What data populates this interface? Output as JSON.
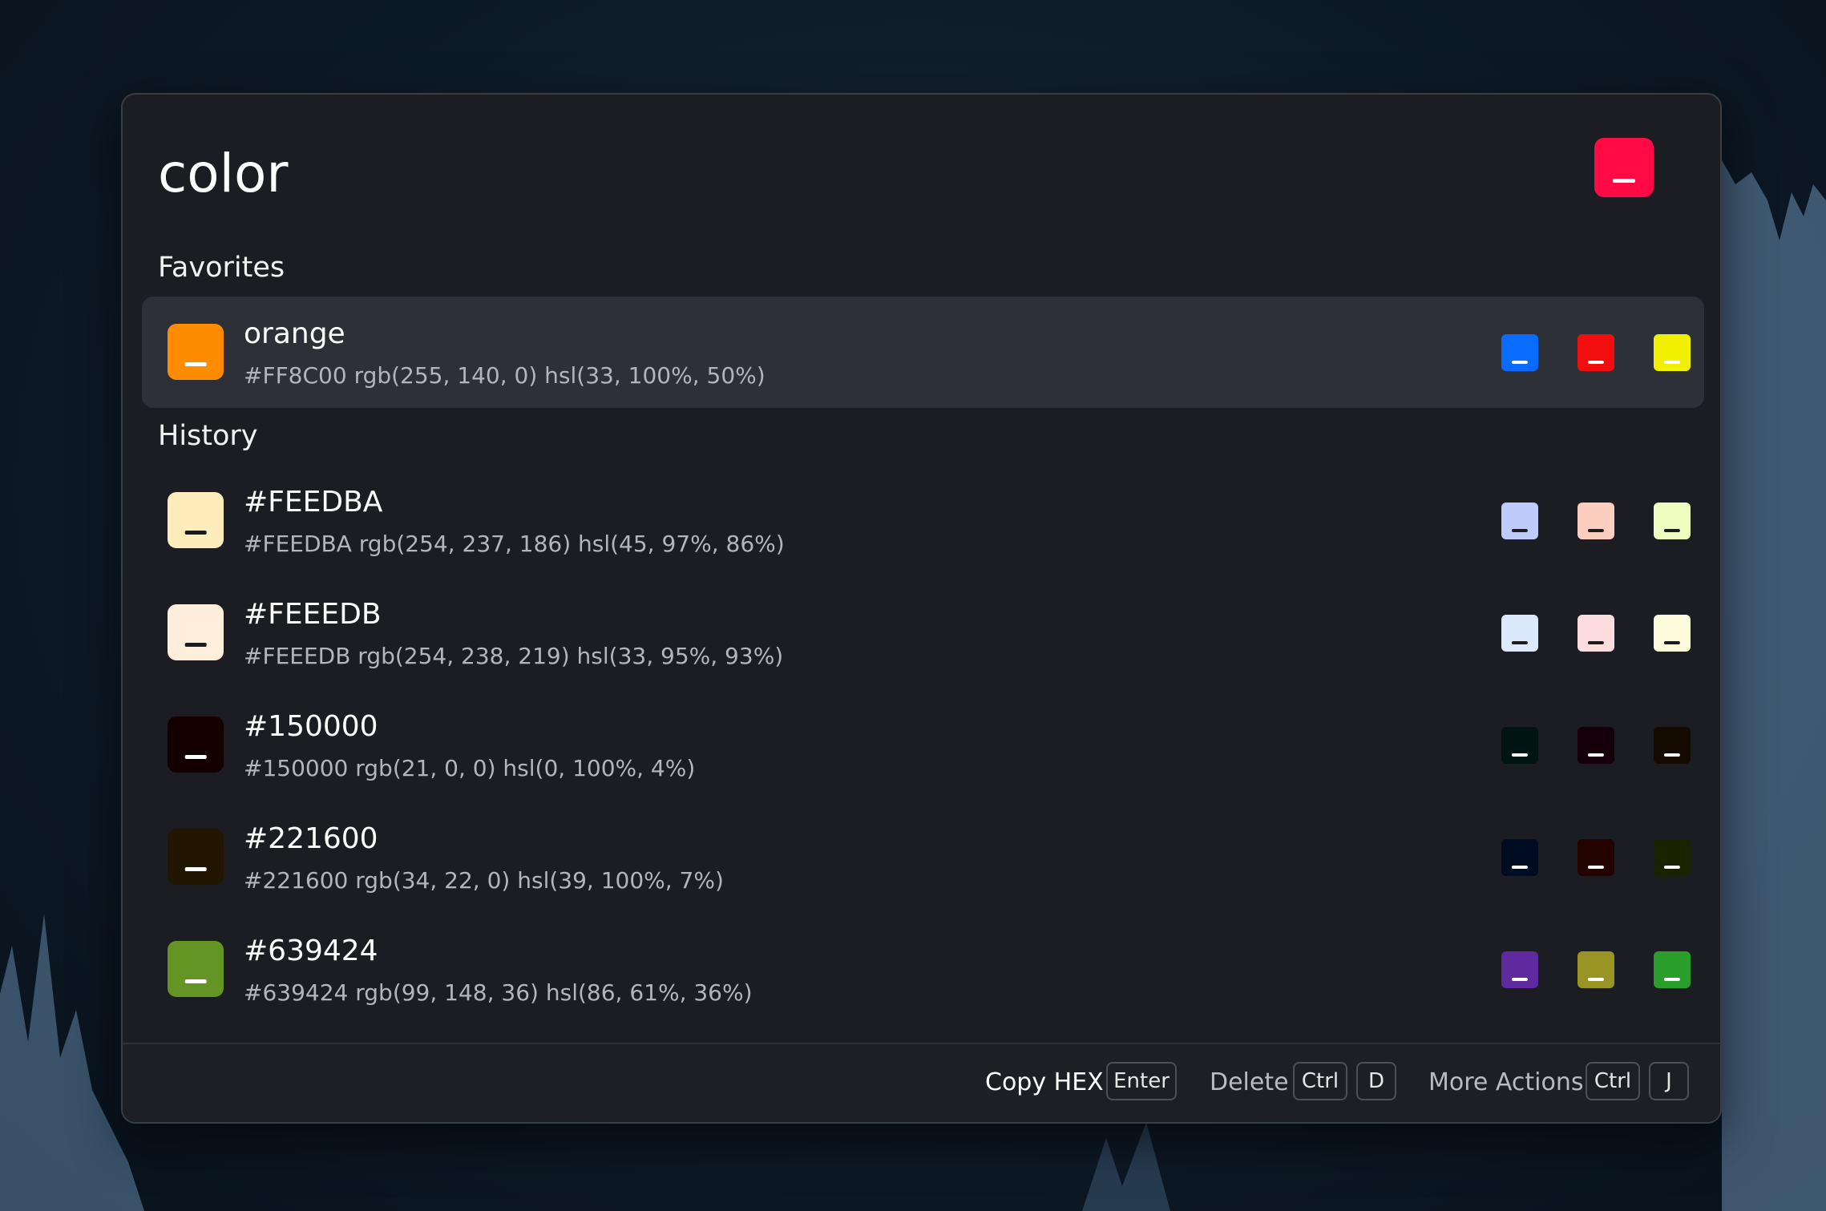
{
  "search": {
    "query": "color",
    "swatch_color": "#FF0A45",
    "swatch_bar_color": "#ffffff"
  },
  "favorites": {
    "title": "Favorites",
    "items": [
      {
        "name": "orange",
        "details": "#FF8C00 rgb(255, 140, 0) hsl(33, 100%, 50%)",
        "color": "#FF8C00",
        "bar": "#ffffff",
        "related": [
          {
            "color": "#0A6CFF",
            "bar": "#ffffff"
          },
          {
            "color": "#F20E0E",
            "bar": "#ffffff"
          },
          {
            "color": "#F0F000",
            "bar": "#ffffff"
          }
        ]
      }
    ]
  },
  "history": {
    "title": "History",
    "items": [
      {
        "name": "#FEEDBA",
        "details": "#FEEDBA rgb(254, 237, 186) hsl(45, 97%, 86%)",
        "color": "#FEEDBA",
        "bar": "#1c1c1c",
        "related": [
          {
            "color": "#BFCBFA",
            "bar": "#1c1c1c"
          },
          {
            "color": "#FCCEBF",
            "bar": "#1c1c1c"
          },
          {
            "color": "#EFFCBF",
            "bar": "#1c1c1c"
          }
        ]
      },
      {
        "name": "#FEEEDB",
        "details": "#FEEEDB rgb(254, 238, 219) hsl(33, 95%, 93%)",
        "color": "#FEEEDB",
        "bar": "#1c1c1c",
        "related": [
          {
            "color": "#DCE9FC",
            "bar": "#1c1c1c"
          },
          {
            "color": "#FCDCDC",
            "bar": "#1c1c1c"
          },
          {
            "color": "#FCFCDC",
            "bar": "#1c1c1c"
          }
        ]
      },
      {
        "name": "#150000",
        "details": "#150000 rgb(21, 0, 0) hsl(0, 100%, 4%)",
        "color": "#150000",
        "bar": "#ffffff",
        "related": [
          {
            "color": "#001512",
            "bar": "#ffffff"
          },
          {
            "color": "#15000A",
            "bar": "#ffffff"
          },
          {
            "color": "#150A00",
            "bar": "#ffffff"
          }
        ]
      },
      {
        "name": "#221600",
        "details": "#221600 rgb(34, 22, 0) hsl(39, 100%, 7%)",
        "color": "#221600",
        "bar": "#ffffff",
        "related": [
          {
            "color": "#000C22",
            "bar": "#ffffff"
          },
          {
            "color": "#220300",
            "bar": "#ffffff"
          },
          {
            "color": "#1A2200",
            "bar": "#ffffff"
          }
        ]
      },
      {
        "name": "#639424",
        "details": "#639424 rgb(99, 148, 36) hsl(86, 61%, 36%)",
        "color": "#639424",
        "bar": "#ffffff",
        "related": [
          {
            "color": "#5E2A9E",
            "bar": "#ffffff"
          },
          {
            "color": "#9A9424",
            "bar": "#ffffff"
          },
          {
            "color": "#2A9E2A",
            "bar": "#ffffff"
          }
        ]
      }
    ]
  },
  "footer": {
    "copy_label": "Copy HEX",
    "copy_key": "Enter",
    "delete_label": "Delete",
    "delete_key_mod": "Ctrl",
    "delete_key": "D",
    "more_label": "More Actions",
    "more_key_mod": "Ctrl",
    "more_key": "J"
  }
}
